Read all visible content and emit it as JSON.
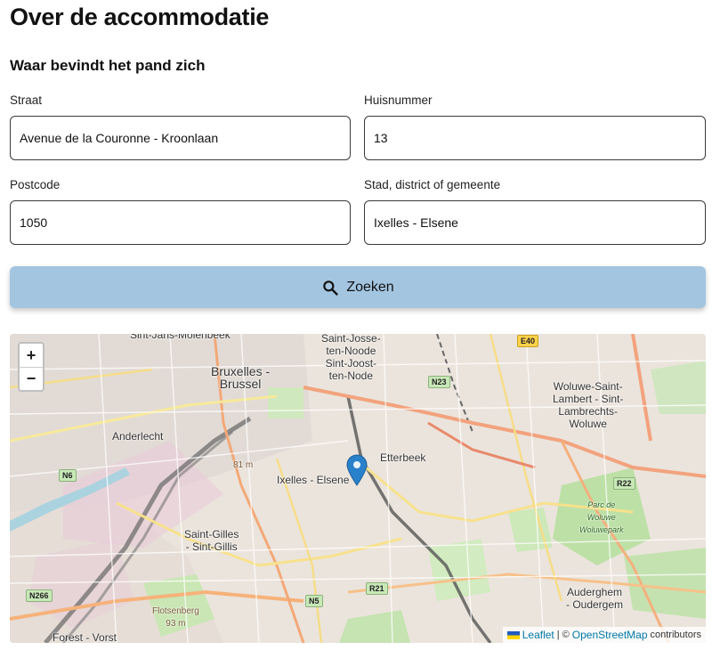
{
  "page": {
    "title": "Over de accommodatie",
    "subtitle": "Waar bevindt het pand zich"
  },
  "form": {
    "street": {
      "label": "Straat",
      "value": "Avenue de la Couronne - Kroonlaan"
    },
    "house_number": {
      "label": "Huisnummer",
      "value": "13"
    },
    "postcode": {
      "label": "Postcode",
      "value": "1050"
    },
    "city": {
      "label": "Stad, district of gemeente",
      "value": "Ixelles - Elsene"
    },
    "search_button": {
      "label": "Zoeken",
      "icon": "search-icon"
    }
  },
  "map": {
    "zoom_in": "+",
    "zoom_out": "−",
    "attribution": {
      "leaflet": "Leaflet",
      "separator": "| ©",
      "osm": "OpenStreetMap",
      "contributors": "contributors"
    },
    "labels": {
      "molenbeek": "Sint-Jans-Molenbeek",
      "saint_josse": "Saint-Josse-\nten-Noode\nSint-Joost-\nten-Node",
      "bruxelles": "Bruxelles -\nBrussel",
      "woluwe": "Woluwe-Saint-\nLambert - Sint-\nLambrechts-\nWoluwe",
      "anderlecht": "Anderlecht",
      "etterbeek": "Etterbeek",
      "ixelles": "Ixelles - Elsene",
      "elevation_81": "81 m",
      "saint_gilles": "Saint-Gilles\n- Sint-Gillis",
      "parc_woluwe": "Parc de\nWoluwe\nWoluwepark",
      "auderghem": "Auderghem\n- Oudergem",
      "flotsenberg": "Flotsenberg\n93 m",
      "forest": "Forest - Vorst"
    },
    "shields": {
      "e40": "E40",
      "n23": "N23",
      "n6": "N6",
      "r22": "R22",
      "n266": "N266",
      "n5": "N5",
      "r21": "R21"
    }
  }
}
